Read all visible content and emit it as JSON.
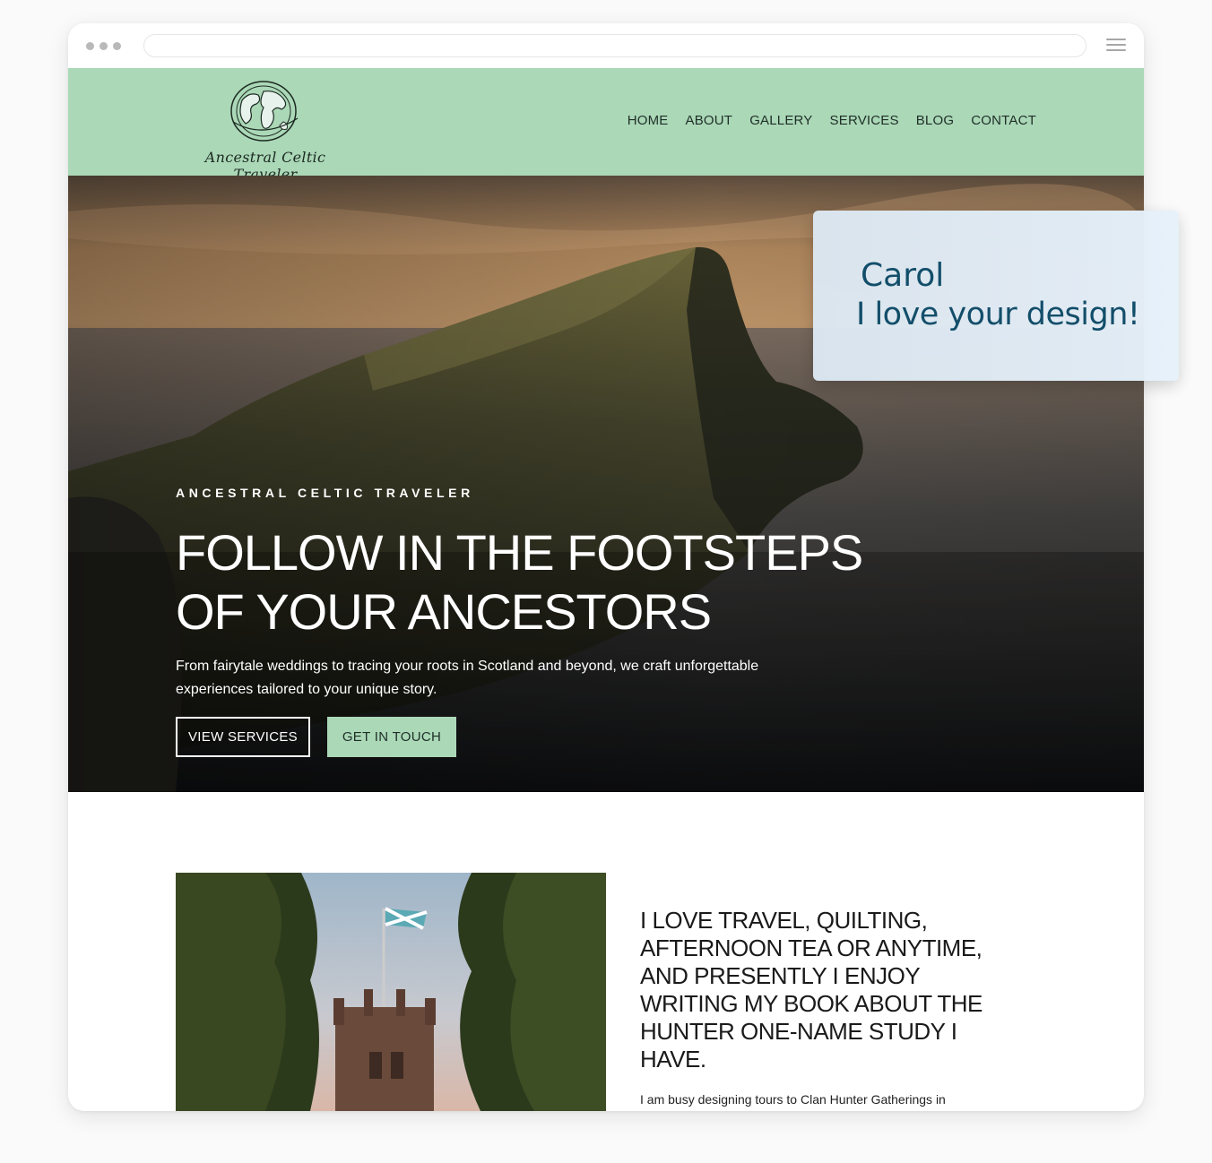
{
  "browser": {
    "menu_icon": "hamburger-icon"
  },
  "site": {
    "logo_text": "Ancestral Celtic Traveler",
    "logo_icon": "globe-icon",
    "nav": [
      "HOME",
      "ABOUT",
      "GALLERY",
      "SERVICES",
      "BLOG",
      "CONTACT"
    ],
    "colors": {
      "header_bg": "#abd8b7",
      "accent": "#abd8b7",
      "text_dark": "#1f2f28"
    }
  },
  "hero": {
    "eyebrow": "ANCESTRAL CELTIC TRAVELER",
    "headline_line1": "FOLLOW IN THE FOOTSTEPS",
    "headline_line2": "OF YOUR ANCESTORS",
    "subtext": "From fairytale weddings to tracing your roots in Scotland and beyond, we craft unforgettable experiences tailored to your unique story.",
    "btn_services": "VIEW SERVICES",
    "btn_contact": "GET IN TOUCH"
  },
  "about": {
    "title": "I LOVE TRAVEL, QUILTING, AFTERNOON TEA OR ANYTIME, AND PRESENTLY I ENJOY WRITING MY BOOK ABOUT THE HUNTER ONE-NAME STUDY I HAVE.",
    "body": "I am busy designing tours to Clan Hunter Gatherings in"
  },
  "testimonial": {
    "name": "Carol",
    "quote": "I love your design!",
    "color": "#0e4d6b"
  }
}
